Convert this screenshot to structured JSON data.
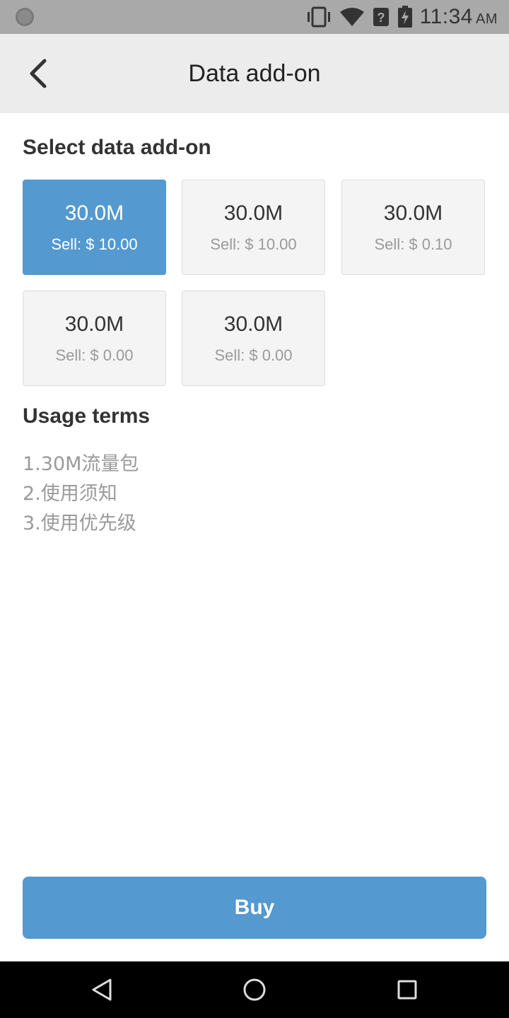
{
  "status_bar": {
    "time": "11:34",
    "ampm": "AM",
    "icons": [
      "notification-dot-icon",
      "vibrate-icon",
      "wifi-icon",
      "signal-unknown-icon",
      "battery-charging-icon"
    ]
  },
  "app_bar": {
    "title": "Data add-on",
    "back_icon": "chevron-left-icon"
  },
  "select_section": {
    "title": "Select data add-on",
    "selected_index": 0,
    "packages": [
      {
        "size": "30.0M",
        "price": "Sell: $ 10.00"
      },
      {
        "size": "30.0M",
        "price": "Sell: $ 10.00"
      },
      {
        "size": "30.0M",
        "price": "Sell: $ 0.10"
      },
      {
        "size": "30.0M",
        "price": "Sell: $ 0.00"
      },
      {
        "size": "30.0M",
        "price": "Sell: $ 0.00"
      }
    ]
  },
  "usage_section": {
    "title": "Usage terms",
    "terms": [
      "1.30M流量包",
      "2.使用须知",
      "3.使用优先级"
    ]
  },
  "buy_button": {
    "label": "Buy"
  },
  "nav_bar": {
    "icons": [
      "nav-back-icon",
      "nav-home-icon",
      "nav-recent-apps-icon"
    ]
  },
  "colors": {
    "accent": "#5499cf",
    "status_bar_bg": "#a9a9a9",
    "app_bar_bg": "#ececec",
    "card_bg": "#f4f4f4",
    "muted_text": "#9a9a9a"
  }
}
